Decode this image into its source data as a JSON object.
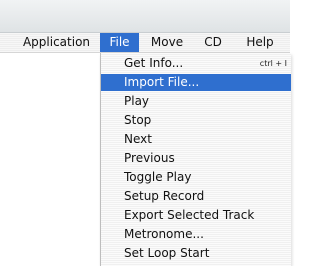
{
  "menubar": {
    "items": [
      {
        "label": "Application"
      },
      {
        "label": "File"
      },
      {
        "label": "Move"
      },
      {
        "label": "CD"
      },
      {
        "label": "Help"
      }
    ]
  },
  "file_menu": {
    "items": [
      {
        "label": "Get Info...",
        "shortcut": "ctrl + I"
      },
      {
        "label": "Import File..."
      },
      {
        "label": "Play"
      },
      {
        "label": "Stop"
      },
      {
        "label": "Next"
      },
      {
        "label": "Previous"
      },
      {
        "label": "Toggle Play"
      },
      {
        "label": "Setup Record"
      },
      {
        "label": "Export Selected Track"
      },
      {
        "label": "Metronome..."
      },
      {
        "label": "Set Loop Start"
      }
    ]
  },
  "colors": {
    "accent": "#2f6fcf"
  }
}
